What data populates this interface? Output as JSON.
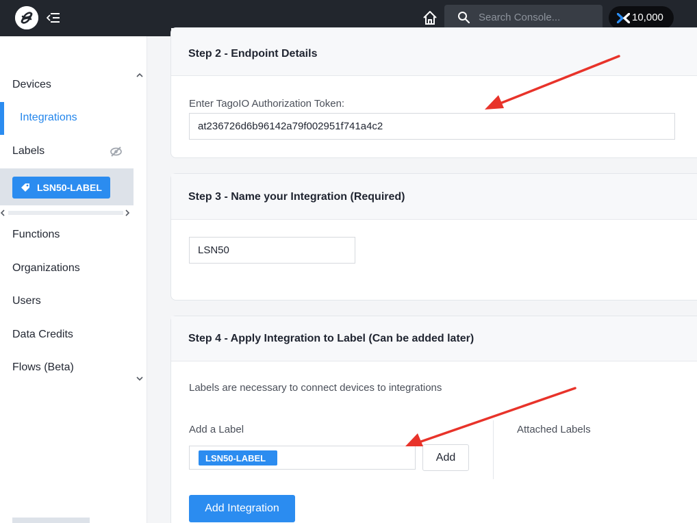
{
  "topbar": {
    "search_placeholder": "Search Console...",
    "data_credits": "10,000"
  },
  "sidebar": {
    "items": [
      {
        "label": "Devices"
      },
      {
        "label": "Integrations"
      },
      {
        "label": "Labels"
      },
      {
        "label": "Functions"
      },
      {
        "label": "Organizations"
      },
      {
        "label": "Users"
      },
      {
        "label": "Data Credits"
      },
      {
        "label": "Flows (Beta)"
      }
    ],
    "label_chip": "LSN50-LABEL"
  },
  "step2": {
    "title": "Step 2 - Endpoint Details",
    "token_label": "Enter TagoIO Authorization Token:",
    "token_value": "at236726d6b96142a79f002951f741a4c2"
  },
  "step3": {
    "title": "Step 3 - Name your Integration (Required)",
    "name_value": "LSN50"
  },
  "step4": {
    "title": "Step 4 - Apply Integration to Label (Can be added later)",
    "description": "Labels are necessary to connect devices to integrations",
    "add_label": "Add a Label",
    "attached_labels": "Attached Labels",
    "selected_label": "LSN50-LABEL",
    "add_button": "Add"
  },
  "actions": {
    "add_integration": "Add Integration"
  },
  "colors": {
    "accent": "#2b8cf0",
    "topbar": "#22262d",
    "annotation_arrow": "#e8332a"
  }
}
